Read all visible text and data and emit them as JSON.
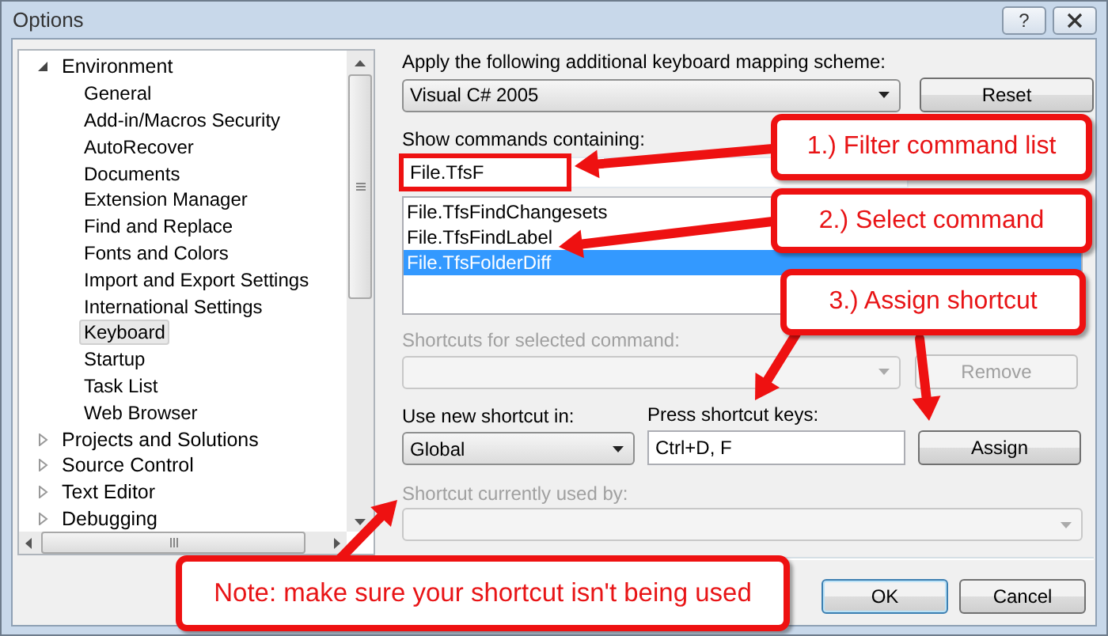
{
  "window": {
    "title": "Options",
    "help_button": "?"
  },
  "tree": {
    "items": [
      {
        "label": "Environment",
        "expanded": true,
        "selected": false,
        "children": [
          {
            "label": "General",
            "selected": false
          },
          {
            "label": "Add-in/Macros Security",
            "selected": false
          },
          {
            "label": "AutoRecover",
            "selected": false
          },
          {
            "label": "Documents",
            "selected": false
          },
          {
            "label": "Extension Manager",
            "selected": false
          },
          {
            "label": "Find and Replace",
            "selected": false
          },
          {
            "label": "Fonts and Colors",
            "selected": false
          },
          {
            "label": "Import and Export Settings",
            "selected": false
          },
          {
            "label": "International Settings",
            "selected": false
          },
          {
            "label": "Keyboard",
            "selected": true
          },
          {
            "label": "Startup",
            "selected": false
          },
          {
            "label": "Task List",
            "selected": false
          },
          {
            "label": "Web Browser",
            "selected": false
          }
        ]
      },
      {
        "label": "Projects and Solutions",
        "expanded": false,
        "selected": false
      },
      {
        "label": "Source Control",
        "expanded": false,
        "selected": false
      },
      {
        "label": "Text Editor",
        "expanded": false,
        "selected": false
      },
      {
        "label": "Debugging",
        "expanded": false,
        "selected": false
      }
    ]
  },
  "mapping_scheme": {
    "label": "Apply the following additional keyboard mapping scheme:",
    "value": "Visual C# 2005"
  },
  "reset_button": {
    "label": "Reset",
    "disabled": false
  },
  "command_filter": {
    "label": "Show commands containing:",
    "value": "File.TfsF",
    "highlighted": true
  },
  "commands": [
    {
      "label": "File.TfsFindChangesets",
      "selected": false
    },
    {
      "label": "File.TfsFindLabel",
      "selected": false
    },
    {
      "label": "File.TfsFolderDiff",
      "selected": true
    }
  ],
  "command_shortcuts": {
    "label": "Shortcuts for selected command:",
    "disabled": true
  },
  "remove_button": {
    "label": "Remove",
    "disabled": true
  },
  "shortcut_scope": {
    "label": "Use new shortcut in:",
    "value": "Global"
  },
  "shortcut_keys": {
    "label": "Press shortcut keys:",
    "value": "Ctrl+D, F"
  },
  "assign_button": {
    "label": "Assign",
    "disabled": false
  },
  "used_by": {
    "label": "Shortcut currently used by:",
    "disabled": true
  },
  "buttons": [
    {
      "label": "OK",
      "default": true
    },
    {
      "label": "Cancel",
      "default": false
    }
  ],
  "callouts": [
    {
      "text": "1.) Filter command list"
    },
    {
      "text": "2.) Select command"
    },
    {
      "text": "3.) Assign shortcut"
    },
    {
      "text": "Note: make sure your shortcut isn't being used"
    }
  ]
}
